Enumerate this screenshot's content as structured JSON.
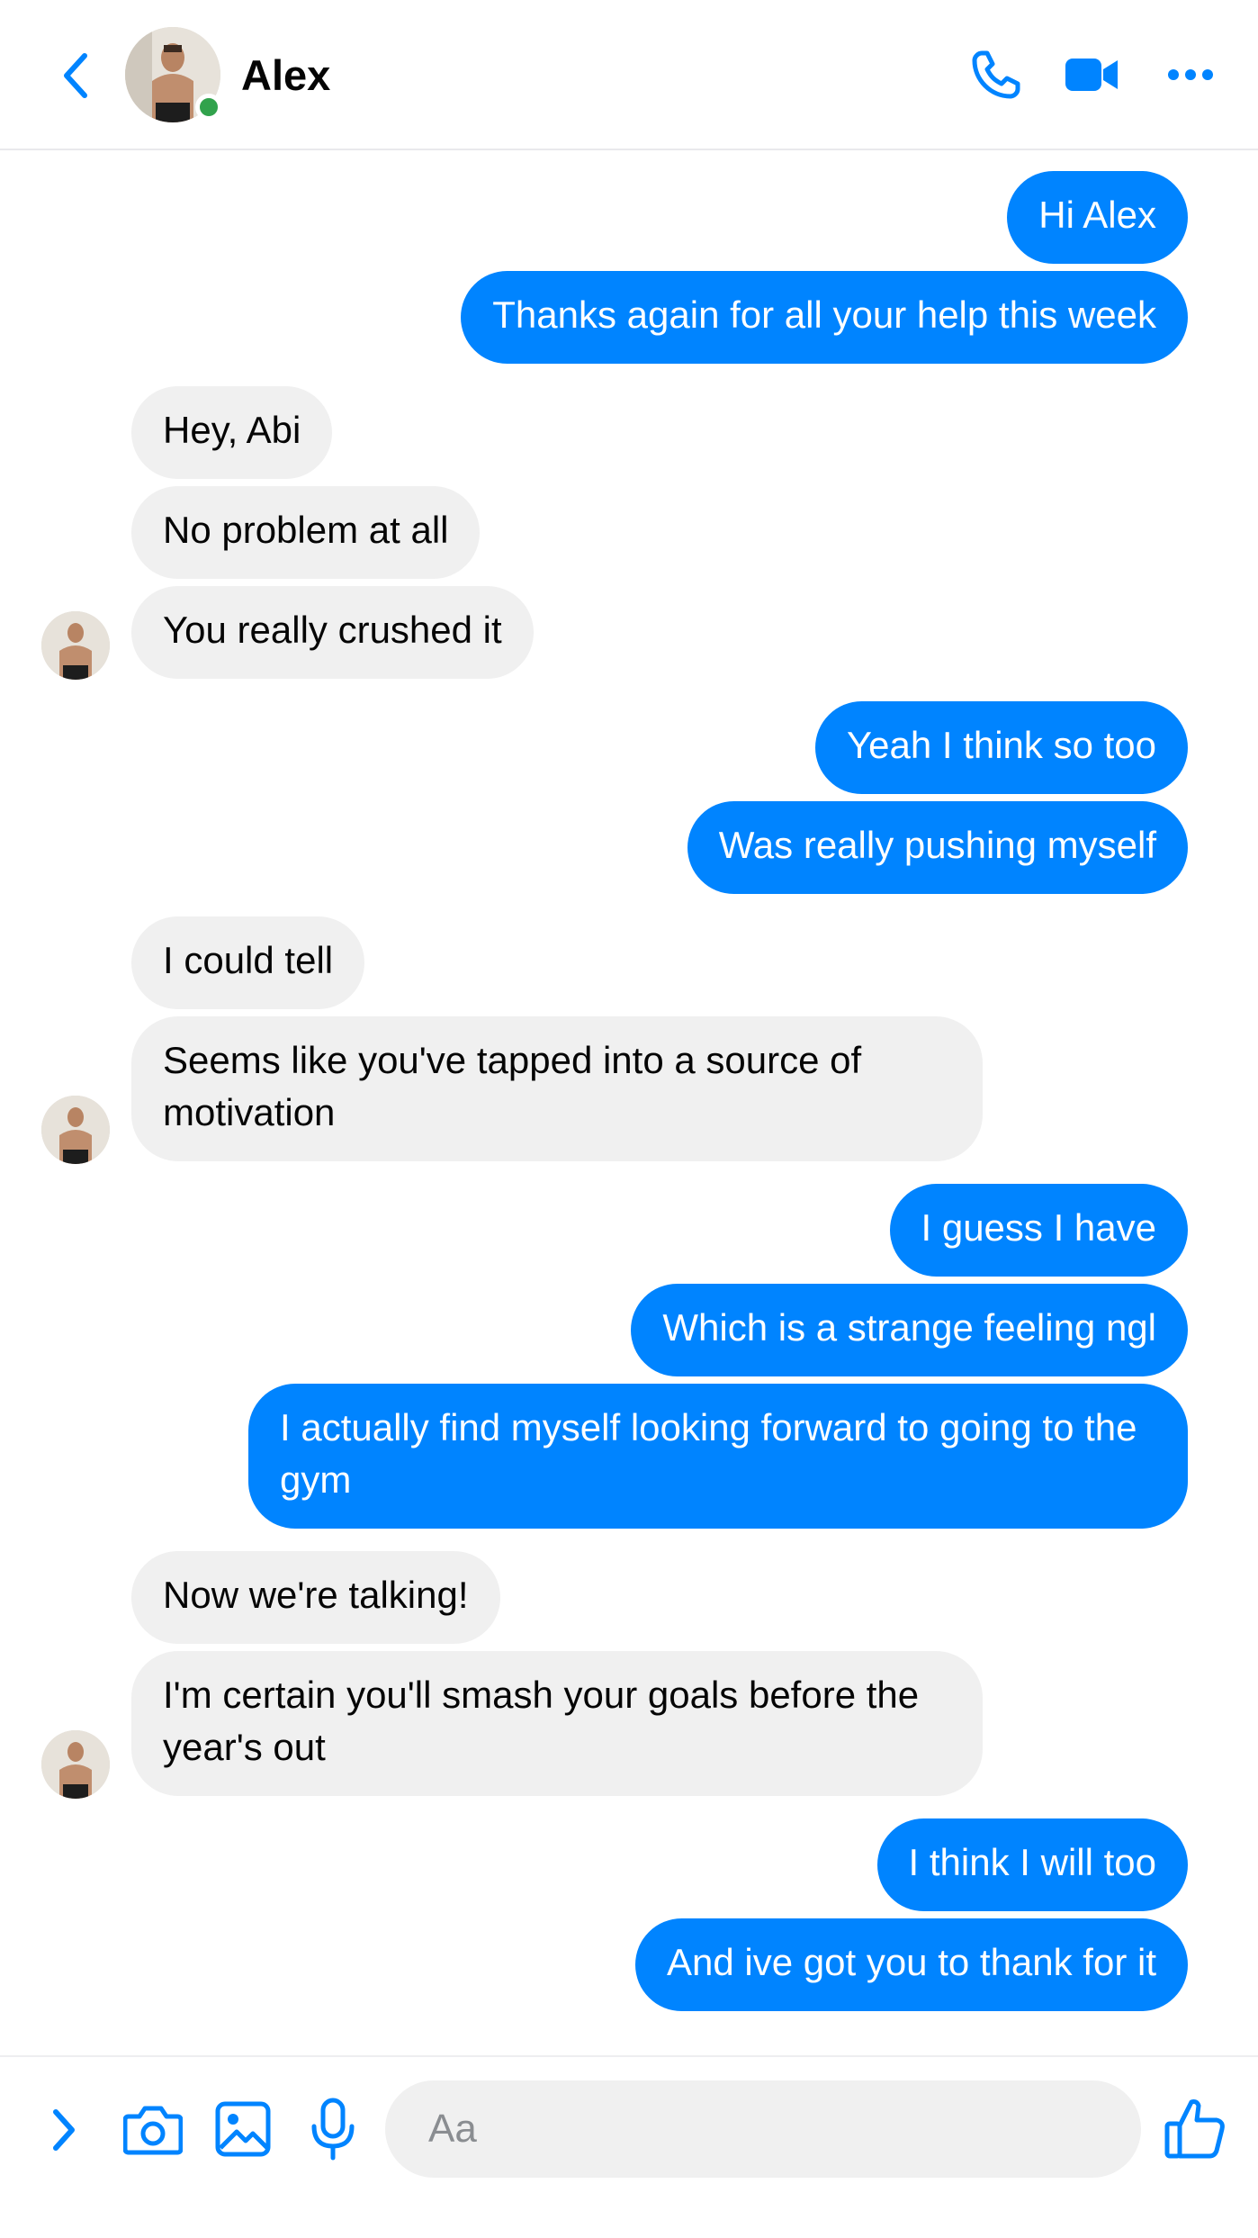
{
  "header": {
    "contact_name": "Alex",
    "online": true,
    "icons": [
      "back-chevron-icon",
      "phone-icon",
      "video-camera-icon",
      "more-dots-icon"
    ]
  },
  "colors": {
    "accent": "#0084ff",
    "incoming_bubble": "#f0f0f0",
    "online": "#31a24c"
  },
  "messages": [
    {
      "from": "me",
      "text": "Hi Alex"
    },
    {
      "from": "me",
      "text": "Thanks again for all your help this week"
    },
    {
      "from": "them",
      "text": "Hey, Abi"
    },
    {
      "from": "them",
      "text": "No problem at all"
    },
    {
      "from": "them",
      "text": "You really crushed it"
    },
    {
      "from": "me",
      "text": "Yeah I think so too"
    },
    {
      "from": "me",
      "text": "Was really pushing myself"
    },
    {
      "from": "them",
      "text": "I could tell"
    },
    {
      "from": "them",
      "text": "Seems like you've tapped into a source of motivation"
    },
    {
      "from": "me",
      "text": "I guess I have"
    },
    {
      "from": "me",
      "text": "Which is a strange feeling ngl"
    },
    {
      "from": "me",
      "text": "I actually find myself looking forward to going to the gym"
    },
    {
      "from": "them",
      "text": "Now we're talking!"
    },
    {
      "from": "them",
      "text": "I'm certain you'll smash your goals before the year's out"
    },
    {
      "from": "me",
      "text": "I think I will too"
    },
    {
      "from": "me",
      "text": "And ive got you to thank for it"
    }
  ],
  "composer": {
    "placeholder": "Aa",
    "icons": [
      "expand-chevron-icon",
      "camera-icon",
      "image-icon",
      "microphone-icon",
      "thumbs-up-icon"
    ]
  }
}
